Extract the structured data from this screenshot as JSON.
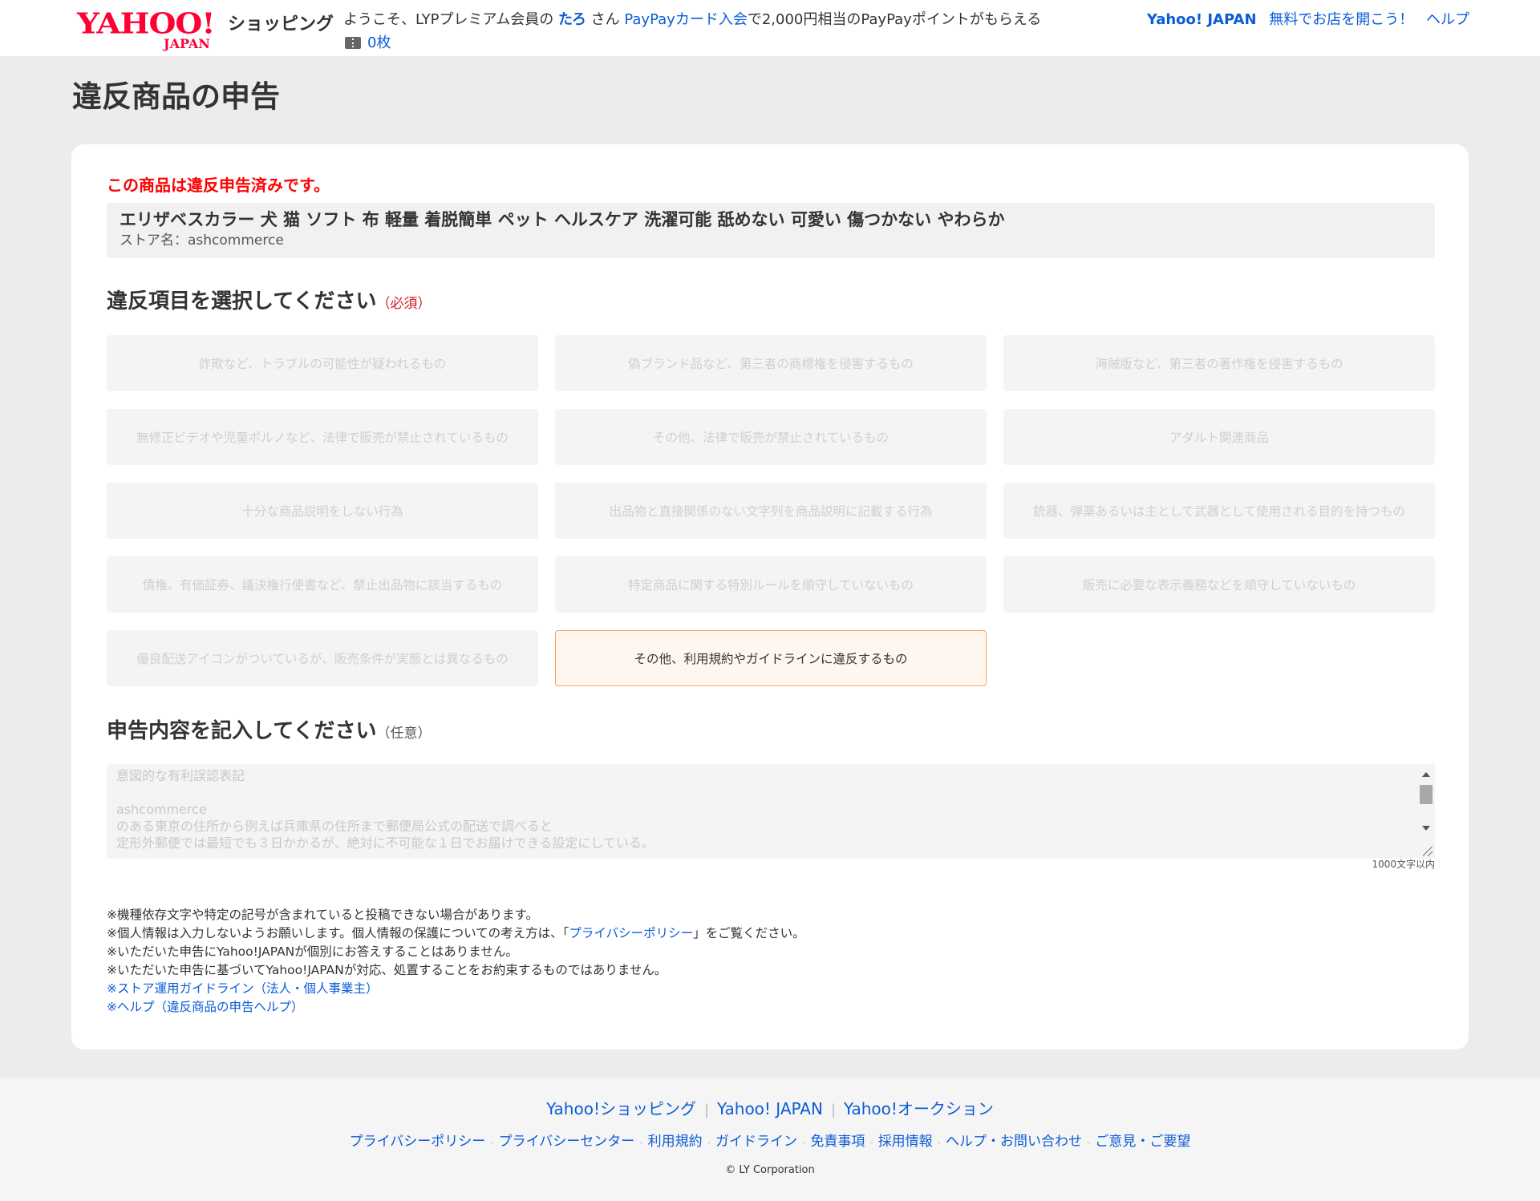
{
  "header": {
    "logo_main": "YAHOO!",
    "logo_sub": "JAPAN",
    "shop_name": "ショッピング",
    "welcome_prefix": "ようこそ、LYPプレミアム会員の",
    "user_name": "たろ",
    "welcome_san": "さん",
    "card_link": "PayPayカード入会",
    "card_suffix": "で2,000円相当のPayPayポイントがもらえる",
    "coupon_count": "0枚",
    "links": {
      "yahoo_japan": "Yahoo! JAPAN",
      "open_store": "無料でお店を開こう！",
      "help": "ヘルプ"
    }
  },
  "page_title": "違反商品の申告",
  "already_reported": "この商品は違反申告済みです。",
  "product": {
    "name": "エリザベスカラー 犬 猫 ソフト 布 軽量 着脱簡単 ペット ヘルスケア 洗濯可能 舐めない 可愛い 傷つかない やわらか",
    "store": "ストア名：ashcommerce"
  },
  "violation_section": {
    "title": "違反項目を選択してください",
    "required": "（必須）",
    "options": [
      "詐欺など、トラブルの可能性が疑われるもの",
      "偽ブランド品など、第三者の商標権を侵害するもの",
      "海賊版など、第三者の著作権を侵害するもの",
      "無修正ビデオや児童ポルノなど、法律で販売が禁止されているもの",
      "その他、法律で販売が禁止されているもの",
      "アダルト関連商品",
      "十分な商品説明をしない行為",
      "出品物と直接関係のない文字列を商品説明に記載する行為",
      "銃器、弾薬あるいは主として武器として使用される目的を持つもの",
      "債権、有価証券、議決権行使書など、禁止出品物に該当するもの",
      "特定商品に関する特別ルールを順守していないもの",
      "販売に必要な表示義務などを順守していないもの",
      "優良配送アイコンがついているが、販売条件が実態とは異なるもの",
      "その他、利用規約やガイドラインに違反するもの"
    ],
    "selected_index": 13
  },
  "content_section": {
    "title": "申告内容を記入してください",
    "optional": "（任意）",
    "textarea_value": "意図的な有利誤認表記\n\nashcommerce\nのある東京の住所から例えば兵庫県の住所まで郵便局公式の配送で調べると\n定形外郵便では最短でも３日かかるが、絶対に不可能な１日でお届けできる設定にしている。",
    "char_limit": "1000文字以内"
  },
  "notes": {
    "n1": "※機種依存文字や特定の記号が含まれていると投稿できない場合があります。",
    "n2_prefix": "※個人情報は入力しないようお願いします。個人情報の保護についての考え方は、「",
    "n2_link": "プライバシーポリシー",
    "n2_suffix": "」をご覧ください。",
    "n3": "※いただいた申告にYahoo!JAPANが個別にお答えすることはありません。",
    "n4": "※いただいた申告に基づいてYahoo!JAPANが対応、処置することをお約束するものではありません。",
    "link_guideline": "※ストア運用ガイドライン（法人・個人事業主）",
    "link_help": "※ヘルプ（違反商品の申告ヘルプ）"
  },
  "footer": {
    "main_links": [
      "Yahoo!ショッピング",
      "Yahoo! JAPAN",
      "Yahoo!オークション"
    ],
    "sub_links": [
      "プライバシーポリシー",
      "プライバシーセンター",
      "利用規約",
      "ガイドライン",
      "免責事項",
      "採用情報",
      "ヘルプ・お問い合わせ",
      "ご意見・ご要望"
    ],
    "copyright": "© LY Corporation"
  }
}
